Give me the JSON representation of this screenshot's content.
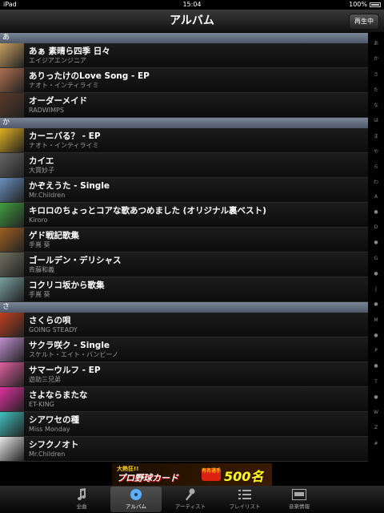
{
  "status_bar": {
    "device": "iPad",
    "time": "15:04",
    "battery": "100%"
  },
  "nav": {
    "title": "アルバム",
    "now_playing": "再生中"
  },
  "sections": [
    {
      "header": "あ",
      "items": [
        {
          "title": "あぁ 素晴ら四季 日々",
          "artist": "エイジアエンジニア",
          "color": "#c8a060"
        },
        {
          "title": "ありったけのLove Song - EP",
          "artist": "ナオト・インティライミ",
          "color": "#b07050"
        },
        {
          "title": "オーダーメイド",
          "artist": "RADWIMPS",
          "color": "#5a3a2a"
        }
      ]
    },
    {
      "header": "か",
      "items": [
        {
          "title": "カーニバる？ - EP",
          "artist": "ナオト・インティライミ",
          "color": "#e0b020"
        },
        {
          "title": "カイエ",
          "artist": "大貫妙子",
          "color": "#666666"
        },
        {
          "title": "かぞえうた - Single",
          "artist": "Mr.Children",
          "color": "#6a90c0"
        },
        {
          "title": "キロロのちょっとコアな歌あつめました (オリジナル裏ベスト)",
          "artist": "Kiroro",
          "color": "#40a040"
        },
        {
          "title": "ゲド戦記歌集",
          "artist": "手嶌 葵",
          "color": "#a06020"
        },
        {
          "title": "ゴールデン・デリシャス",
          "artist": "斉藤和義",
          "color": "#707060"
        },
        {
          "title": "コクリコ坂から歌集",
          "artist": "手嶌 葵",
          "color": "#7aa0a0"
        }
      ]
    },
    {
      "header": "さ",
      "items": [
        {
          "title": "さくらの唄",
          "artist": "GOING STEADY",
          "color": "#c04020"
        },
        {
          "title": "サクラ咲ク - Single",
          "artist": "スケルト・エイト・バンビーノ",
          "color": "#c090d0"
        },
        {
          "title": "サマーウルフ - EP",
          "artist": "遊助三兄弟",
          "color": "#e060a0"
        },
        {
          "title": "さよならまたな",
          "artist": "ET-KING",
          "color": "#e030a0"
        },
        {
          "title": "シアワセの種",
          "artist": "Miss Monday",
          "color": "#40c0c0"
        },
        {
          "title": "シフクノオト",
          "artist": "Mr.Children",
          "color": "#e8e8e8"
        }
      ]
    }
  ],
  "index": [
    "あ",
    "か",
    "さ",
    "た",
    "な",
    "は",
    "ま",
    "や",
    "ら",
    "わ",
    "A",
    "●",
    "D",
    "●",
    "G",
    "●",
    "J",
    "●",
    "M",
    "●",
    "P",
    "●",
    "T",
    "●",
    "W",
    "Z",
    "#"
  ],
  "ad": {
    "line1": "大熱狂!!",
    "line2": "プロ野球カード",
    "badge": "有名選手",
    "count": "500名登場!!"
  },
  "tabs": [
    {
      "label": "全曲",
      "icon": "music-note-icon"
    },
    {
      "label": "アルバム",
      "icon": "album-disc-icon",
      "selected": true
    },
    {
      "label": "アーティスト",
      "icon": "microphone-icon"
    },
    {
      "label": "プレイリスト",
      "icon": "playlist-icon"
    },
    {
      "label": "音楽情報",
      "icon": "news-icon"
    }
  ]
}
